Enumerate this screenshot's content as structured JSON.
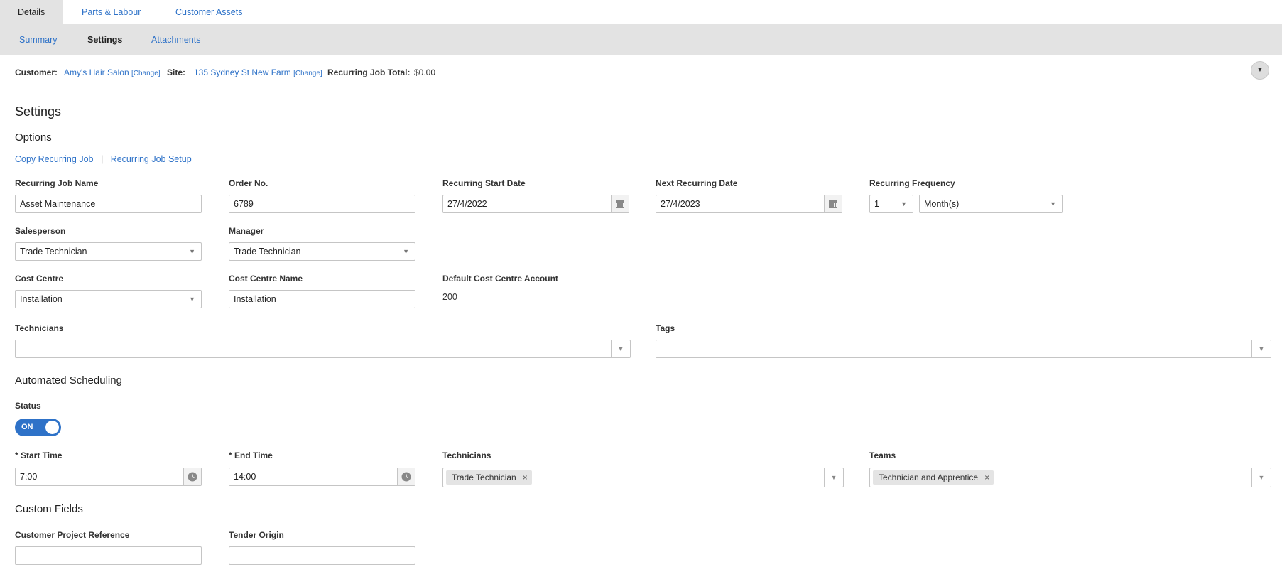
{
  "top_tabs": [
    "Details",
    "Parts & Labour",
    "Customer Assets"
  ],
  "sub_tabs": [
    "Summary",
    "Settings",
    "Attachments"
  ],
  "info": {
    "customer_label": "Customer:",
    "customer_value": "Amy's Hair Salon",
    "change_label": "[Change]",
    "site_label": "Site:",
    "site_value": "135 Sydney St New Farm",
    "total_label": "Recurring Job Total:",
    "total_value": "$0.00"
  },
  "page": {
    "title": "Settings",
    "options_heading": "Options",
    "copy_link": "Copy Recurring Job",
    "separator": "|",
    "setup_link": "Recurring Job Setup"
  },
  "fields": {
    "job_name_label": "Recurring Job Name",
    "job_name_value": "Asset Maintenance",
    "order_label": "Order No.",
    "order_value": "6789",
    "start_date_label": "Recurring Start Date",
    "start_date_value": "27/4/2022",
    "next_date_label": "Next Recurring Date",
    "next_date_value": "27/4/2023",
    "frequency_label": "Recurring Frequency",
    "frequency_number": "1",
    "frequency_unit": "Month(s)",
    "salesperson_label": "Salesperson",
    "salesperson_value": "Trade Technician",
    "manager_label": "Manager",
    "manager_value": "Trade Technician",
    "cost_centre_label": "Cost Centre",
    "cost_centre_value": "Installation",
    "cost_centre_name_label": "Cost Centre Name",
    "cost_centre_name_value": "Installation",
    "default_account_label": "Default Cost Centre Account",
    "default_account_value": "200",
    "technicians_label": "Technicians",
    "tags_label": "Tags"
  },
  "scheduling": {
    "heading": "Automated Scheduling",
    "status_label": "Status",
    "status_value": "ON",
    "start_time_label": "* Start Time",
    "start_time_value": "7:00",
    "end_time_label": "* End Time",
    "end_time_value": "14:00",
    "technicians_label": "Technicians",
    "technician_chip": "Trade Technician",
    "teams_label": "Teams",
    "team_chip": "Technician and Apprentice",
    "chip_remove": "×"
  },
  "custom_fields": {
    "heading": "Custom Fields",
    "project_ref_label": "Customer Project Reference",
    "project_ref_value": "",
    "tender_label": "Tender Origin",
    "tender_value": ""
  },
  "colors": {
    "link": "#2e72c8",
    "tab_bg": "#e3e3e3",
    "toggle_on": "#2e72c8"
  },
  "icons": {
    "calendar": "calendar-icon",
    "clock": "clock-icon",
    "dropdown": "chevron-down-icon"
  }
}
